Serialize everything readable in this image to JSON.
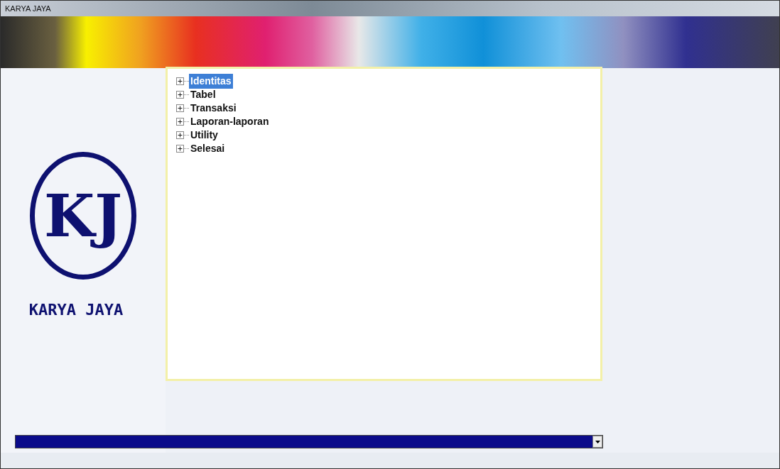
{
  "window": {
    "title": "KARYA JAYA"
  },
  "logo": {
    "monogram": "KJ",
    "caption": "KARYA JAYA"
  },
  "tree": {
    "items": [
      {
        "label": "Identitas",
        "selected": true,
        "expanded": false
      },
      {
        "label": "Tabel",
        "selected": false,
        "expanded": false
      },
      {
        "label": "Transaksi",
        "selected": false,
        "expanded": false
      },
      {
        "label": "Laporan-laporan",
        "selected": false,
        "expanded": false
      },
      {
        "label": "Utility",
        "selected": false,
        "expanded": false
      },
      {
        "label": "Selesai",
        "selected": false,
        "expanded": false
      }
    ]
  },
  "combo": {
    "kind": "dropdown"
  }
}
